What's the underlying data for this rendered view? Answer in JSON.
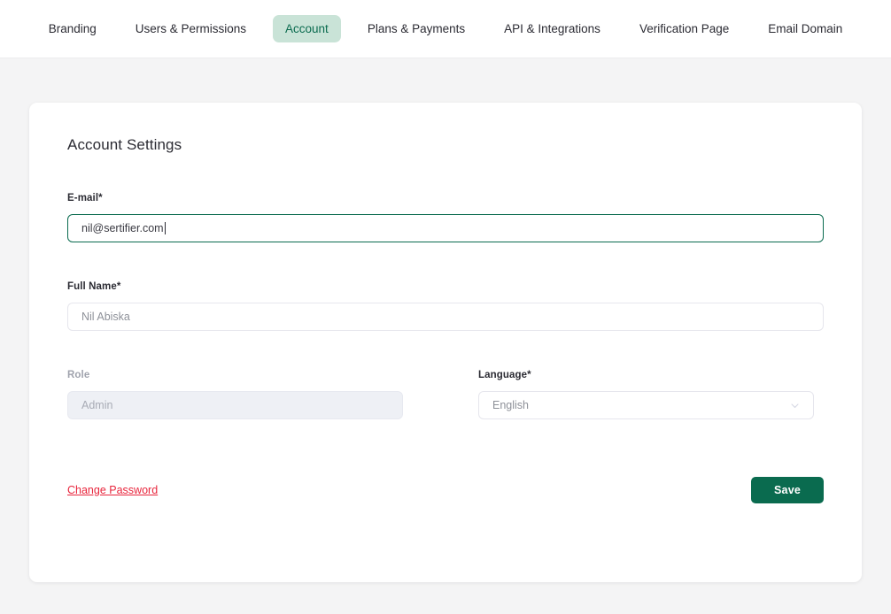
{
  "nav": {
    "tabs": [
      {
        "label": "Branding",
        "active": false
      },
      {
        "label": "Users & Permissions",
        "active": false
      },
      {
        "label": "Account",
        "active": true
      },
      {
        "label": "Plans & Payments",
        "active": false
      },
      {
        "label": "API & Integrations",
        "active": false
      },
      {
        "label": "Verification Page",
        "active": false
      },
      {
        "label": "Email Domain",
        "active": false
      }
    ]
  },
  "card": {
    "title": "Account Settings",
    "email": {
      "label": "E-mail*",
      "value": "nil@sertifier.com",
      "placeholder": "E-mail"
    },
    "full_name": {
      "label": "Full Name*",
      "value": "Nil Abiska",
      "placeholder": "Nil Abiska"
    },
    "role": {
      "label": "Role",
      "value": "Admin",
      "placeholder": "Admin"
    },
    "language": {
      "label": "Language*",
      "value": "English",
      "icon": "chevron-down-icon"
    },
    "change_password_label": "Change Password",
    "save_label": "Save"
  },
  "colors": {
    "accent_green": "#0a6b4f",
    "tab_active_bg": "#c9e3d7",
    "danger_red": "#e8253c",
    "page_bg": "#f4f4f5",
    "disabled_bg": "#eef0f5"
  }
}
